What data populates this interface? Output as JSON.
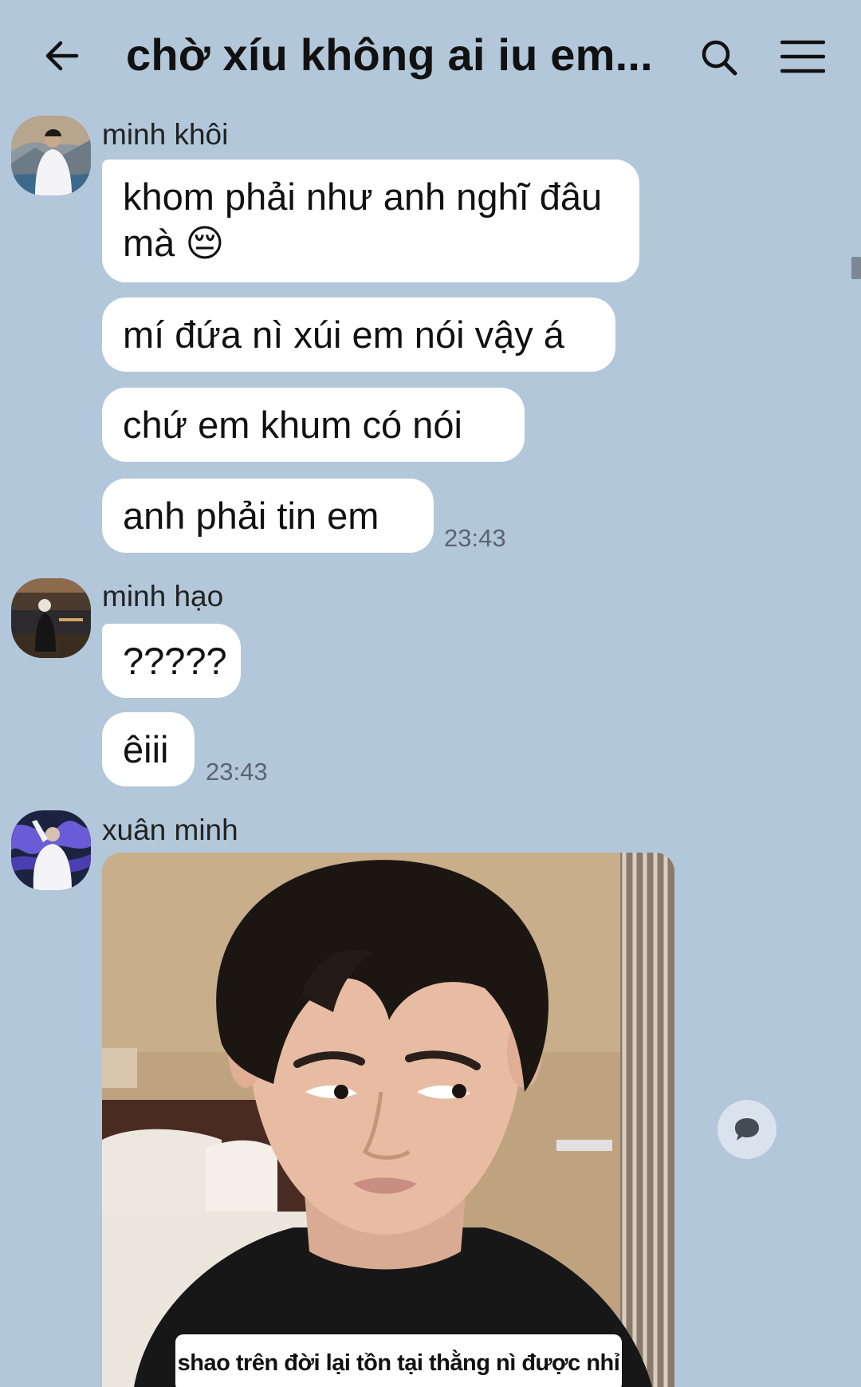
{
  "header": {
    "title": "chờ xíu không ai iu em...",
    "back_icon": "arrow-left-icon",
    "search_icon": "search-icon",
    "menu_icon": "hamburger-menu-icon"
  },
  "messages": [
    {
      "sender": "minh khôi",
      "bubbles": [
        "khom phải như anh nghĩ đâu mà 😔",
        "mí đứa nì xúi em nói vậy á",
        "chứ em khum có nói",
        "anh phải tin em"
      ],
      "time": "23:43"
    },
    {
      "sender": "minh hạo",
      "bubbles": [
        "?????",
        "êiii"
      ],
      "time": "23:43"
    },
    {
      "sender": "xuân minh",
      "photo_caption": "shao trên đời lại tồn tại thằng nì được nhỉ"
    }
  ],
  "colors": {
    "background": "#b2c7da",
    "bubble": "#ffffff",
    "time_text": "#5a6470"
  }
}
